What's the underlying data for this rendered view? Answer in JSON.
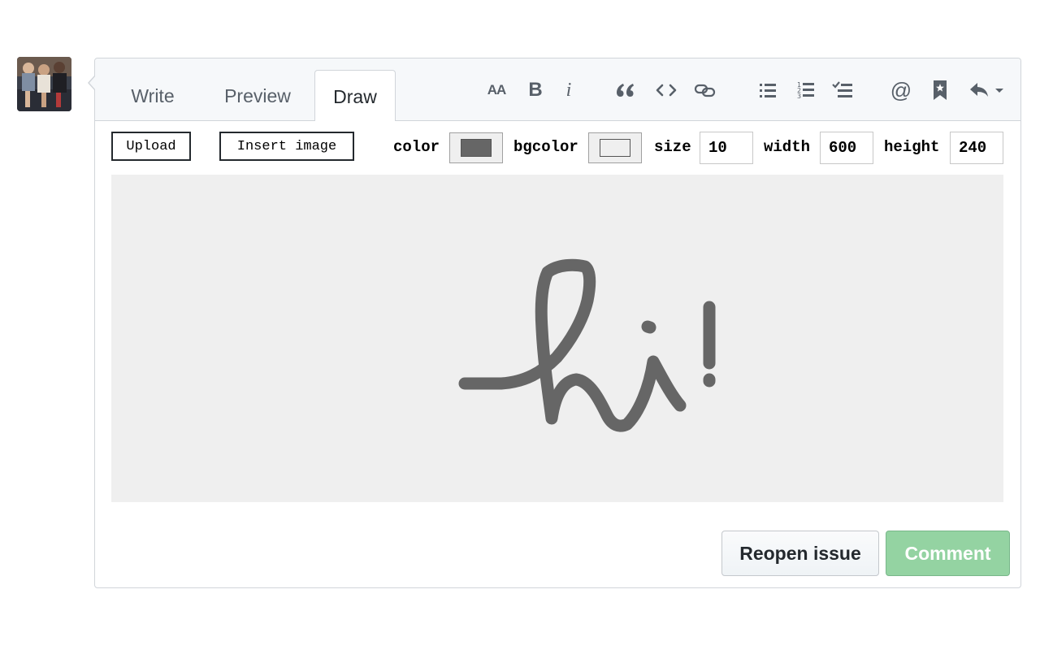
{
  "tabs": [
    {
      "label": "Write",
      "selected": false
    },
    {
      "label": "Preview",
      "selected": false
    },
    {
      "label": "Draw",
      "selected": true
    }
  ],
  "toolbar": {
    "icons": [
      "text-size-icon",
      "bold-icon",
      "italic-icon",
      "quote-icon",
      "code-icon",
      "link-icon",
      "unordered-list-icon",
      "ordered-list-icon",
      "task-list-icon",
      "mention-icon",
      "saved-reply-icon",
      "reply-icon"
    ],
    "heading_label": "AA",
    "bold_label": "B",
    "italic_label": "i",
    "mention_label": "@"
  },
  "drawbar": {
    "upload_label": "Upload",
    "insert_image_label": "Insert image",
    "color_label": "color",
    "color_value": "#666666",
    "bgcolor_label": "bgcolor",
    "bgcolor_value": "#efefef",
    "size_label": "size",
    "size_value": "10",
    "width_label": "width",
    "width_value": "600",
    "height_label": "height",
    "height_value": "240"
  },
  "canvas": {
    "background": "#efefef",
    "stroke_color": "#666666",
    "drawing": "hi!"
  },
  "actions": {
    "reopen_label": "Reopen issue",
    "comment_label": "Comment"
  },
  "colors": {
    "comment_button": "#94d3a2",
    "header_bg": "#f6f8fa",
    "border": "#d1d5da"
  }
}
